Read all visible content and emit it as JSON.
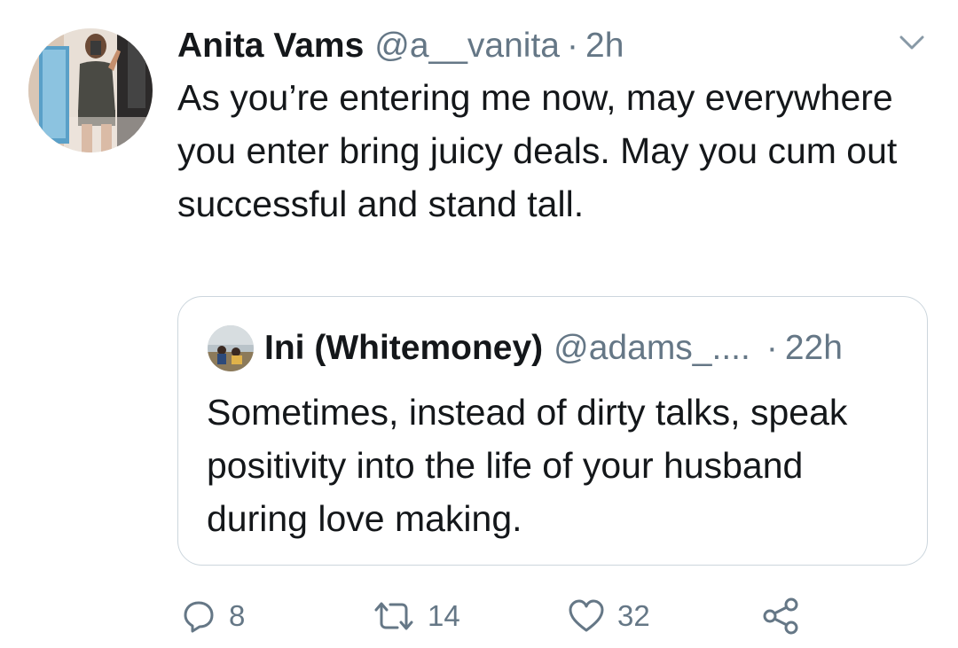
{
  "tweet": {
    "display_name": "Anita Vams",
    "handle": "@a__vanita",
    "separator": "·",
    "time": "2h",
    "text": "As you’re entering me now, may everywhere you enter bring juicy deals. May you cum out successful and stand tall."
  },
  "quoted_tweet": {
    "display_name": "Ini (Whitemoney)",
    "handle": "@adams_....",
    "separator": "·",
    "time": "22h",
    "text": "Sometimes, instead of dirty talks, speak positivity into the life of your husband during love making."
  },
  "actions": {
    "reply_count": "8",
    "retweet_count": "14",
    "like_count": "32"
  },
  "icons": {
    "reply": "reply-icon",
    "retweet": "retweet-icon",
    "like": "heart-icon",
    "share": "share-icon",
    "more": "chevron-down-icon"
  },
  "colors": {
    "text_primary": "#14171a",
    "text_secondary": "#657786",
    "border": "#ccd6dd"
  }
}
